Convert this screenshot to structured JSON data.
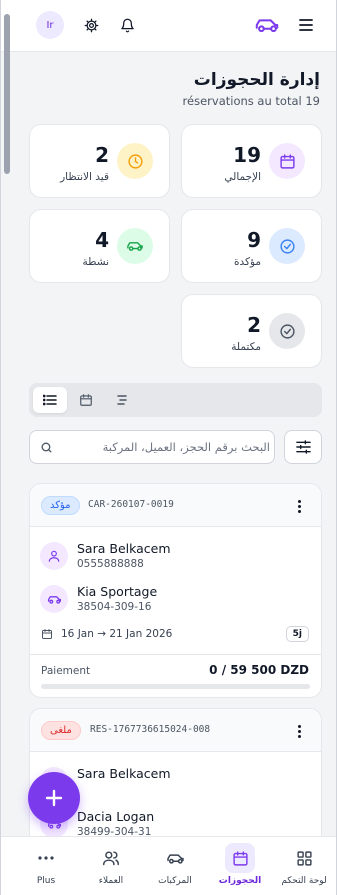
{
  "header": {
    "avatar_initials": "Ir",
    "title": "إدارة الحجوزات",
    "subtitle": "réservations au total 19"
  },
  "stats": [
    {
      "value": "19",
      "label": "الإجمالي",
      "icon": "calendar-icon",
      "color": "#7c3aed"
    },
    {
      "value": "2",
      "label": "قيد الانتظار",
      "icon": "clock-icon",
      "color": "#f59e0b"
    },
    {
      "value": "9",
      "label": "مؤكدة",
      "icon": "check-circle-icon",
      "color": "#3b82f6"
    },
    {
      "value": "4",
      "label": "نشطة",
      "icon": "car-icon",
      "color": "#16a34a"
    },
    {
      "value": "2",
      "label": "مكتملة",
      "icon": "check-circle-icon",
      "color": "#4b5563"
    }
  ],
  "search": {
    "placeholder": "البحث برقم الحجز، العميل، المركبة"
  },
  "bookings": [
    {
      "status": "مؤكد",
      "status_color": "#2563eb",
      "reference": "CAR-260107-0019",
      "client_name": "Sara Belkacem",
      "client_phone": "0555888888",
      "vehicle_name": "Kia Sportage",
      "vehicle_plate": "38504-309-16",
      "dates": "16 Jan → 21 Jan 2026",
      "days": "5j",
      "payment_label": "Paiement",
      "payment_value": "0 / 59 500 DZD",
      "payment_progress": 0
    },
    {
      "status": "ملغى",
      "status_color": "#dc2626",
      "reference": "RES-1767736615024-008",
      "client_name": "Sara Belkacem",
      "vehicle_name": "Dacia Logan",
      "vehicle_plate": "38499-304-31"
    }
  ],
  "nav": [
    {
      "label": "لوحة التحكم",
      "icon": "dashboard-icon",
      "active": false
    },
    {
      "label": "الحجوزات",
      "icon": "calendar-icon",
      "active": true
    },
    {
      "label": "المركبات",
      "icon": "car-icon",
      "active": false
    },
    {
      "label": "العملاء",
      "icon": "users-icon",
      "active": false
    },
    {
      "label": "Plus",
      "icon": "more-icon",
      "active": false
    }
  ],
  "colors": {
    "accent": "#7c3aed",
    "background": "#f3f4f6"
  }
}
